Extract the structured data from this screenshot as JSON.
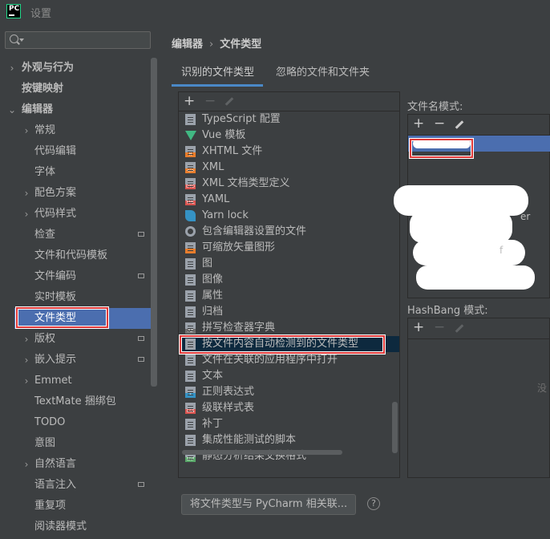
{
  "window": {
    "title": "设置",
    "app_icon": "pycharm-icon"
  },
  "sidebar": {
    "search_placeholder": "",
    "items": [
      {
        "label": "外观与行为",
        "chevron": "›",
        "bold": true
      },
      {
        "label": "按键映射",
        "chevron": "",
        "bold": true
      },
      {
        "label": "编辑器",
        "chevron": "⌄",
        "bold": true
      },
      {
        "label": "常规",
        "chevron": "›",
        "bold": false
      },
      {
        "label": "代码编辑",
        "chevron": "",
        "bold": false
      },
      {
        "label": "字体",
        "chevron": "",
        "bold": false
      },
      {
        "label": "配色方案",
        "chevron": "›",
        "bold": false
      },
      {
        "label": "代码样式",
        "chevron": "›",
        "bold": false
      },
      {
        "label": "检查",
        "chevron": "",
        "bold": false
      },
      {
        "label": "文件和代码模板",
        "chevron": "",
        "bold": false
      },
      {
        "label": "文件编码",
        "chevron": "",
        "bold": false
      },
      {
        "label": "实时模板",
        "chevron": "",
        "bold": false
      },
      {
        "label": "文件类型",
        "chevron": "",
        "bold": false
      },
      {
        "label": "版权",
        "chevron": "›",
        "bold": false
      },
      {
        "label": "嵌入提示",
        "chevron": "›",
        "bold": false
      },
      {
        "label": "Emmet",
        "chevron": "›",
        "bold": false
      },
      {
        "label": "TextMate 捆绑包",
        "chevron": "",
        "bold": false
      },
      {
        "label": "TODO",
        "chevron": "",
        "bold": false
      },
      {
        "label": "意图",
        "chevron": "",
        "bold": false
      },
      {
        "label": "自然语言",
        "chevron": "›",
        "bold": false
      },
      {
        "label": "语言注入",
        "chevron": "",
        "bold": false
      },
      {
        "label": "重复项",
        "chevron": "",
        "bold": false
      },
      {
        "label": "阅读器模式",
        "chevron": "",
        "bold": false
      }
    ]
  },
  "breadcrumb": {
    "parent": "编辑器",
    "separator": "›",
    "current": "文件类型"
  },
  "tabs": [
    {
      "label": "识别的文件类型",
      "active": true
    },
    {
      "label": "忽略的文件和文件夹",
      "active": false
    }
  ],
  "file_types": {
    "toolbar": {
      "add": "+",
      "remove": "−"
    },
    "items": [
      {
        "label": "TypeScript 配置",
        "icon": "doc-icon"
      },
      {
        "label": "Vue 模板",
        "icon": "vue-icon"
      },
      {
        "label": "XHTML 文件",
        "icon": "xhtml-icon"
      },
      {
        "label": "XML",
        "icon": "xml-icon"
      },
      {
        "label": "XML 文档类型定义",
        "icon": "dtd-icon"
      },
      {
        "label": "YAML",
        "icon": "yaml-icon"
      },
      {
        "label": "Yarn lock",
        "icon": "yarn-icon"
      },
      {
        "label": "包含编辑器设置的文件",
        "icon": "gear-icon"
      },
      {
        "label": "可缩放矢量图形",
        "icon": "svg-icon"
      },
      {
        "label": "图",
        "icon": "diagram-icon"
      },
      {
        "label": "图像",
        "icon": "image-icon"
      },
      {
        "label": "属性",
        "icon": "properties-icon"
      },
      {
        "label": "归档",
        "icon": "archive-icon"
      },
      {
        "label": "拼写检查器字典",
        "icon": "dictionary-icon"
      },
      {
        "label": "按文件内容自动检测到的文件类型",
        "icon": "doc-icon",
        "selected": true
      },
      {
        "label": "文件在关联的应用程序中打开",
        "icon": "user-icon"
      },
      {
        "label": "文本",
        "icon": "text-icon"
      },
      {
        "label": "正则表达式",
        "icon": "regex-icon"
      },
      {
        "label": "级联样式表",
        "icon": "css-icon"
      },
      {
        "label": "补丁",
        "icon": "patch-icon"
      },
      {
        "label": "集成性能测试的脚本",
        "icon": "script-icon"
      },
      {
        "label": "静态分析结果交换格式",
        "icon": "sarif-icon"
      }
    ]
  },
  "patterns": {
    "label": "文件名模式:",
    "toolbar": {
      "add": "+",
      "remove": "−"
    },
    "visible_fragments": [
      "er",
      "f"
    ]
  },
  "hashbang": {
    "label": "HashBang 模式:",
    "toolbar": {
      "add": "+",
      "remove": "−"
    },
    "hint": "没"
  },
  "footer": {
    "associate_button": "将文件类型与 PyCharm 相关联...",
    "help": "?"
  },
  "colors": {
    "selection": "#4b6eaf",
    "list_selection": "#0d293e",
    "highlight_box": "#e03a3a",
    "tab_underline": "#4a88c7"
  }
}
